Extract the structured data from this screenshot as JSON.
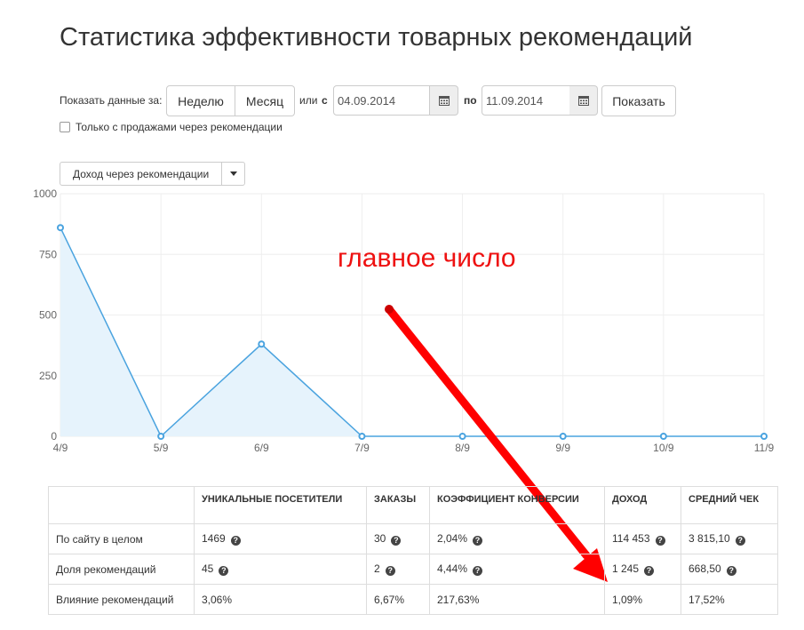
{
  "page_title": "Статистика эффективности товарных рекомендаций",
  "filters": {
    "show_data_for_label": "Показать данные за:",
    "week_button": "Неделю",
    "month_button": "Месяц",
    "or_label": "или",
    "from_label": "с",
    "date_from": "04.09.2014",
    "to_label": "по",
    "date_to": "11.09.2014",
    "show_button": "Показать",
    "checkbox_label": "Только с продажами через рекомендации",
    "checkbox_checked": false
  },
  "metric_select": {
    "selected": "Доход через рекомендации"
  },
  "annotation": {
    "text": "главное число",
    "color": "#ee1111"
  },
  "colors": {
    "line": "#4aa3df",
    "area": "#e6f3fc",
    "grid": "#eeeeee",
    "annotation_arrow": "#ff0000"
  },
  "chart_data": {
    "type": "area",
    "categories": [
      "4/9",
      "5/9",
      "6/9",
      "7/9",
      "8/9",
      "9/9",
      "10/9",
      "11/9"
    ],
    "series": [
      {
        "values": [
          860,
          0,
          380,
          0,
          0,
          0,
          0,
          0
        ]
      }
    ],
    "ylim": [
      0,
      1000
    ],
    "yticks": [
      "1000",
      "750",
      "500",
      "250",
      "0"
    ],
    "grid": true,
    "legend": "none"
  },
  "table": {
    "headers": [
      "",
      "УНИКАЛЬНЫЕ ПОСЕТИТЕЛИ",
      "ЗАКАЗЫ",
      "КОЭФФИЦИЕНТ КОНВЕРСИИ",
      "ДОХОД",
      "СРЕДНИЙ ЧЕК"
    ],
    "rows": [
      {
        "label": "По сайту в целом",
        "visitors": "1469",
        "orders": "30",
        "conversion": "2,04%",
        "revenue": "114 453",
        "avg_check": "3 815,10"
      },
      {
        "label": "Доля рекомендаций",
        "visitors": "45",
        "orders": "2",
        "conversion": "4,44%",
        "revenue": "1 245",
        "avg_check": "668,50"
      },
      {
        "label": "Влияние рекомендаций",
        "visitors": "3,06%",
        "orders": "6,67%",
        "conversion": "217,63%",
        "revenue": "1,09%",
        "avg_check": "17,52%"
      }
    ]
  }
}
